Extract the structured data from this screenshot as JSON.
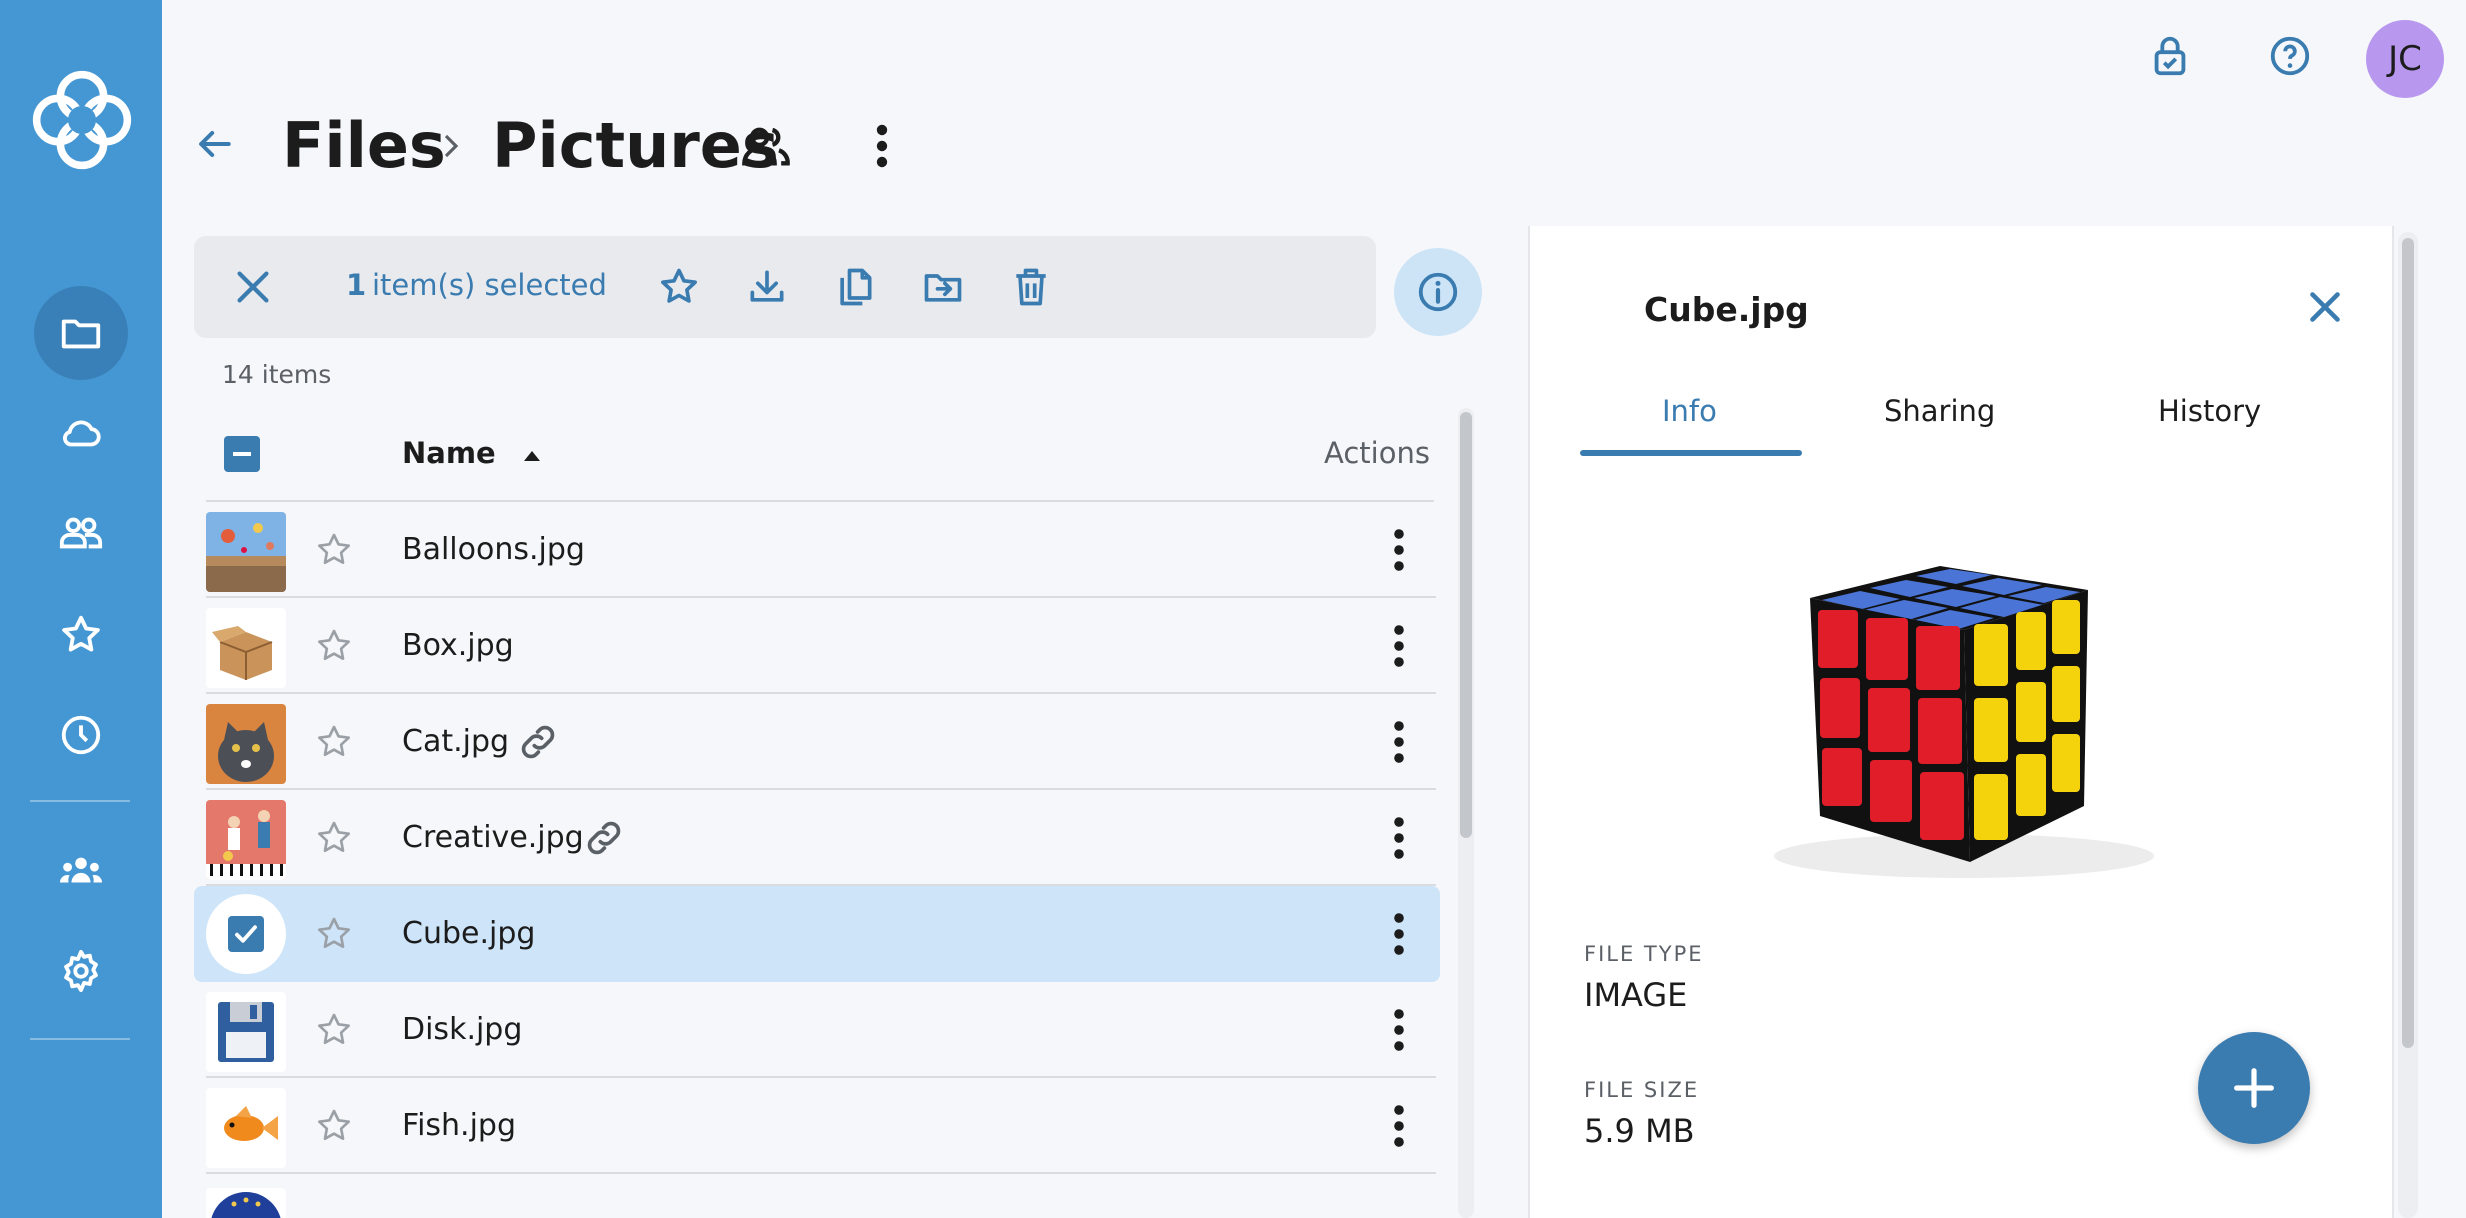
{
  "header": {
    "user_initials": "JC",
    "crumb_root": "Files",
    "crumb_current": "Pictures"
  },
  "selection": {
    "count": "1",
    "text": "item(s) selected"
  },
  "list": {
    "items_count": "14 items",
    "col_name": "Name",
    "col_actions": "Actions",
    "rows": [
      {
        "name": "Balloons.jpg"
      },
      {
        "name": "Box.jpg"
      },
      {
        "name": "Cat.jpg"
      },
      {
        "name": "Creative.jpg"
      },
      {
        "name": "Cube.jpg"
      },
      {
        "name": "Disk.jpg"
      },
      {
        "name": "Fish.jpg"
      }
    ]
  },
  "details": {
    "title": "Cube.jpg",
    "tabs": [
      "Info",
      "Sharing",
      "History"
    ],
    "file_type_label": "FILE TYPE",
    "file_type_value": "IMAGE",
    "file_size_label": "FILE SIZE",
    "file_size_value": "5.9 MB"
  },
  "colors": {
    "sidebar": "#4597d3",
    "accent": "#3a7bb0",
    "selected_row": "#cde4f9",
    "avatar": "#b898ee"
  }
}
